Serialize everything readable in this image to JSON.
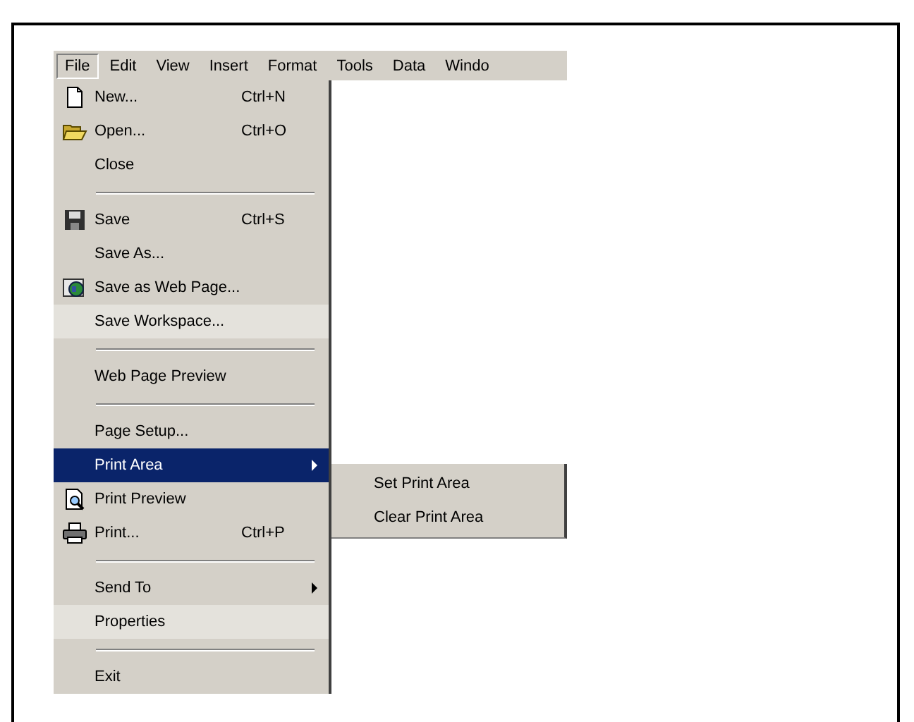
{
  "menubar": [
    {
      "label": "File",
      "selected": true
    },
    {
      "label": "Edit",
      "selected": false
    },
    {
      "label": "View",
      "selected": false
    },
    {
      "label": "Insert",
      "selected": false
    },
    {
      "label": "Format",
      "selected": false
    },
    {
      "label": "Tools",
      "selected": false
    },
    {
      "label": "Data",
      "selected": false
    },
    {
      "label": "Windo",
      "selected": false
    }
  ],
  "file_menu": [
    {
      "kind": "item",
      "label": "New...",
      "shortcut": "Ctrl+N",
      "selected": false,
      "recessed": false
    },
    {
      "kind": "item",
      "label": "Open...",
      "shortcut": "Ctrl+O",
      "selected": false,
      "recessed": false
    },
    {
      "kind": "item",
      "label": "Close",
      "selected": false,
      "recessed": false
    },
    {
      "kind": "separator"
    },
    {
      "kind": "item",
      "label": "Save",
      "shortcut": "Ctrl+S",
      "selected": false,
      "recessed": false
    },
    {
      "kind": "item",
      "label": "Save As...",
      "selected": false,
      "recessed": false
    },
    {
      "kind": "item",
      "label": "Save as Web Page...",
      "selected": false,
      "recessed": false
    },
    {
      "kind": "item",
      "label": "Save Workspace...",
      "selected": false,
      "recessed": true
    },
    {
      "kind": "separator"
    },
    {
      "kind": "item",
      "label": "Web Page Preview",
      "selected": false,
      "recessed": false
    },
    {
      "kind": "separator"
    },
    {
      "kind": "item",
      "label": "Page Setup...",
      "selected": false,
      "recessed": false
    },
    {
      "kind": "item",
      "label": "Print Area",
      "submenu": true,
      "selected": true,
      "recessed": false
    },
    {
      "kind": "item",
      "label": "Print Preview",
      "selected": false,
      "recessed": false
    },
    {
      "kind": "item",
      "label": "Print...",
      "shortcut": "Ctrl+P",
      "selected": false,
      "recessed": false
    },
    {
      "kind": "separator"
    },
    {
      "kind": "item",
      "label": "Send To",
      "submenu": true,
      "selected": false,
      "recessed": false
    },
    {
      "kind": "item",
      "label": "Properties",
      "selected": false,
      "recessed": true
    },
    {
      "kind": "separator"
    },
    {
      "kind": "item",
      "label": "Exit",
      "selected": false,
      "recessed": false
    }
  ],
  "print_area_submenu": [
    {
      "label": "Set Print Area"
    },
    {
      "label": "Clear Print Area"
    }
  ]
}
